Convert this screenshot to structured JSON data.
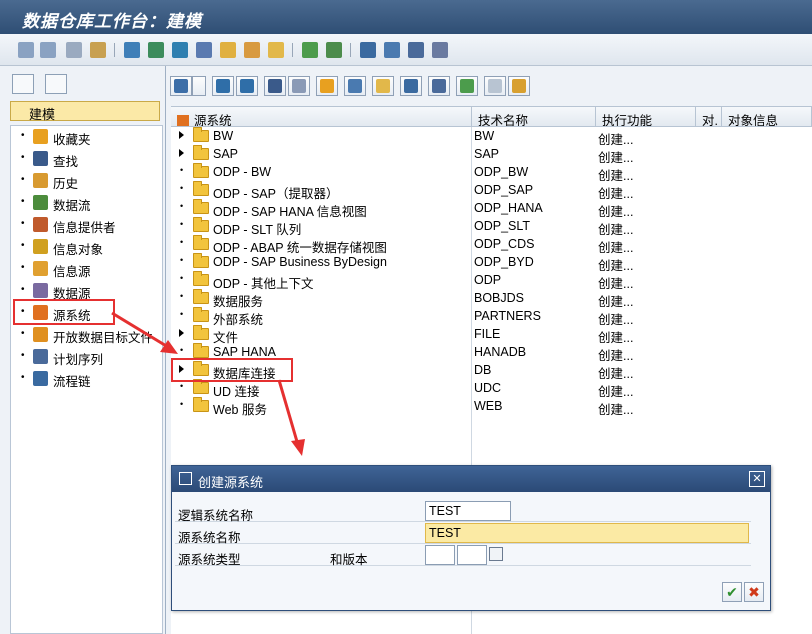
{
  "window": {
    "title": "数据仓库工作台：建模"
  },
  "left": {
    "header": "建模",
    "items": [
      {
        "label": "收藏夹",
        "icon": "star-icon",
        "color": "#e8a020"
      },
      {
        "label": "查找",
        "icon": "binoculars-icon",
        "color": "#3a5a8a"
      },
      {
        "label": "历史",
        "icon": "history-icon",
        "color": "#d89a30"
      },
      {
        "label": "数据流",
        "icon": "dataflow-icon",
        "color": "#4c8c3c"
      },
      {
        "label": "信息提供者",
        "icon": "infoprovider-icon",
        "color": "#c05a2c"
      },
      {
        "label": "信息对象",
        "icon": "infoobject-icon",
        "color": "#d0a020"
      },
      {
        "label": "信息源",
        "icon": "infosource-icon",
        "color": "#e0a030"
      },
      {
        "label": "数据源",
        "icon": "datasource-icon",
        "color": "#7a6aa0"
      },
      {
        "label": "源系统",
        "icon": "source-system-icon",
        "color": "#e07020"
      },
      {
        "label": "开放数据目标文件",
        "icon": "open-hub-icon",
        "color": "#e09020"
      },
      {
        "label": "计划序列",
        "icon": "schedule-icon",
        "color": "#4a6a9a"
      },
      {
        "label": "流程链",
        "icon": "process-chain-icon",
        "color": "#3a6aa0"
      }
    ]
  },
  "grid": {
    "headers": {
      "source": "源系统",
      "tech": "技术名称",
      "func": "执行功能",
      "obj": "对.",
      "objinfo": "对象信息"
    },
    "rows": [
      {
        "name": "BW",
        "tech": "BW",
        "func": "创建...",
        "expand": true
      },
      {
        "name": "SAP",
        "tech": "SAP",
        "func": "创建...",
        "expand": true
      },
      {
        "name": "ODP - BW",
        "tech": "ODP_BW",
        "func": "创建...",
        "expand": false
      },
      {
        "name": "ODP - SAP（提取器）",
        "tech": "ODP_SAP",
        "func": "创建...",
        "expand": false
      },
      {
        "name": "ODP - SAP HANA 信息视图",
        "tech": "ODP_HANA",
        "func": "创建...",
        "expand": false
      },
      {
        "name": "ODP - SLT 队列",
        "tech": "ODP_SLT",
        "func": "创建...",
        "expand": false
      },
      {
        "name": "ODP - ABAP 统一数据存储视图",
        "tech": "ODP_CDS",
        "func": "创建...",
        "expand": false
      },
      {
        "name": "ODP - SAP Business ByDesign",
        "tech": "ODP_BYD",
        "func": "创建...",
        "expand": false
      },
      {
        "name": "ODP - 其他上下文",
        "tech": "ODP",
        "func": "创建...",
        "expand": false
      },
      {
        "name": "数据服务",
        "tech": "BOBJDS",
        "func": "创建...",
        "expand": false
      },
      {
        "name": "外部系统",
        "tech": "PARTNERS",
        "func": "创建...",
        "expand": false
      },
      {
        "name": "文件",
        "tech": "FILE",
        "func": "创建...",
        "expand": true
      },
      {
        "name": "SAP HANA",
        "tech": "HANADB",
        "func": "创建...",
        "expand": false
      },
      {
        "name": "数据库连接",
        "tech": "DB",
        "func": "创建...",
        "expand": true
      },
      {
        "name": "UD 连接",
        "tech": "UDC",
        "func": "创建...",
        "expand": false
      },
      {
        "name": "Web 服务",
        "tech": "WEB",
        "func": "创建...",
        "expand": false
      }
    ]
  },
  "dialog": {
    "title": "创建源系统",
    "close": "✕",
    "logical_label": "逻辑系统名称",
    "logical_value": "TEST",
    "source_label": "源系统名称",
    "source_value": "TEST",
    "type_label": "源系统类型",
    "version_label": "和版本",
    "ok": "✔",
    "cancel": "✖"
  }
}
